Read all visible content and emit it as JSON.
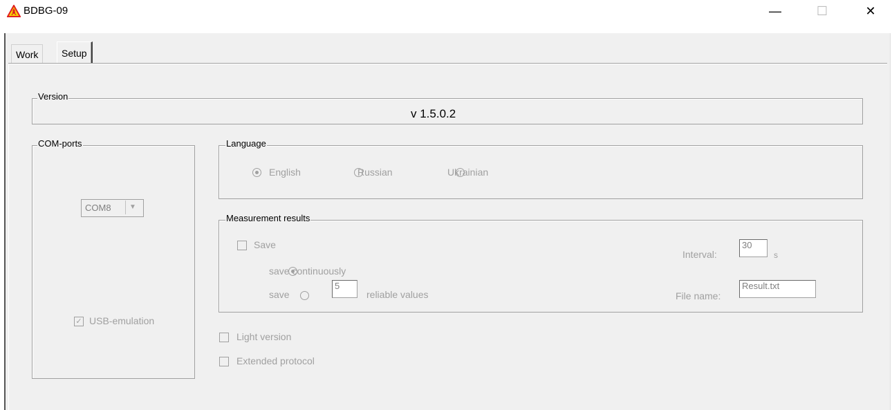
{
  "window": {
    "title": "BDBG-09",
    "min_symbol": "—",
    "max_symbol": "☐",
    "close_symbol": "✕"
  },
  "tabs": [
    {
      "label": "Work",
      "selected": false
    },
    {
      "label": "Setup",
      "selected": true
    }
  ],
  "version": {
    "legend": "Version",
    "value": "v 1.5.0.2"
  },
  "com_ports": {
    "legend": "COM-ports",
    "selected": "COM8",
    "usb_emulation_label": "USB-emulation",
    "usb_emulation_checked": true
  },
  "language": {
    "legend": "Language",
    "options": [
      "English",
      "Russian",
      "Ukrainian"
    ],
    "selected": "English"
  },
  "measurement": {
    "legend": "Measurement results",
    "save_label": "Save",
    "save_checked": false,
    "continuous_label": "save continuously",
    "save_n_label": "save",
    "save_n_value": "5",
    "reliable_label": "reliable values",
    "interval_label": "Interval:",
    "interval_value": "30",
    "interval_unit": "s",
    "filename_label": "File name:",
    "filename_value": "Result.txt"
  },
  "options": {
    "light_version_label": "Light version",
    "extended_protocol_label": "Extended protocol"
  },
  "colors": {
    "disabled_text": "#a0a0a0",
    "dialog_bg": "#f0f0f0",
    "icon_red": "#e02020",
    "icon_yellow": "#f5d300"
  }
}
